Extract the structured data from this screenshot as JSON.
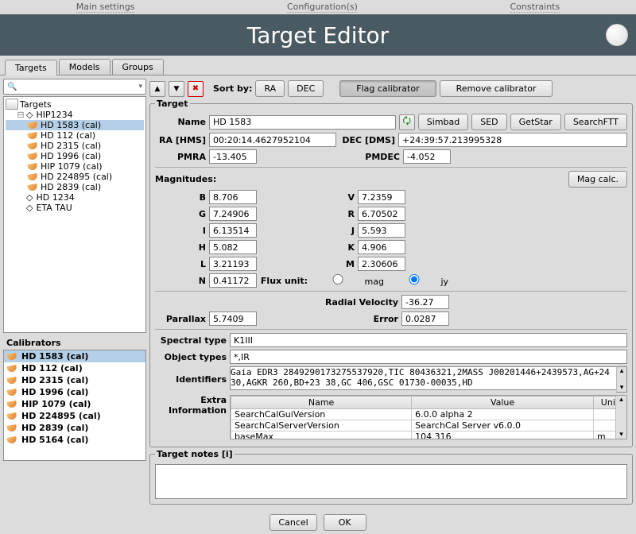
{
  "topmenu": {
    "main": "Main settings",
    "config": "Configuration(s)",
    "constraints": "Constraints"
  },
  "title": "Target Editor",
  "tabs": [
    "Targets",
    "Models",
    "Groups"
  ],
  "search_placeholder": "",
  "search_dropdown_icon": "▾",
  "tree_root": "Targets",
  "tree": [
    {
      "label": "HIP1234",
      "sub": [
        {
          "label": "HD 1583 (cal)",
          "selected": true
        },
        {
          "label": "HD 112 (cal)"
        },
        {
          "label": "HD 2315 (cal)"
        },
        {
          "label": "HD 1996 (cal)"
        },
        {
          "label": "HIP 1079 (cal)"
        },
        {
          "label": "HD 224895 (cal)"
        },
        {
          "label": "HD 2839 (cal)"
        }
      ]
    },
    {
      "label": "HD 1234"
    },
    {
      "label": "ETA TAU"
    }
  ],
  "calibs_title": "Calibrators",
  "calibrators": [
    {
      "label": "HD 1583 (cal)",
      "selected": true
    },
    {
      "label": "HD 112 (cal)"
    },
    {
      "label": "HD 2315 (cal)"
    },
    {
      "label": "HD 1996 (cal)"
    },
    {
      "label": "HIP 1079 (cal)"
    },
    {
      "label": "HD 224895 (cal)"
    },
    {
      "label": "HD 2839 (cal)"
    },
    {
      "label": "HD 5164 (cal)"
    }
  ],
  "toolbar": {
    "sort_by": "Sort by:",
    "ra": "RA",
    "dec": "DEC",
    "flag": "Flag calibrator",
    "remove": "Remove calibrator"
  },
  "target": {
    "legend": "Target",
    "name_label": "Name",
    "name": "HD 1583",
    "simbad": "Simbad",
    "sed": "SED",
    "getstar": "GetStar",
    "searchftt": "SearchFTT",
    "ra_label": "RA [HMS]",
    "ra": "00:20:14.4627952104",
    "dec_label": "DEC [DMS]",
    "dec": "+24:39:57.213995328",
    "pmra_label": "PMRA",
    "pmra": "-13.405",
    "pmdec_label": "PMDEC",
    "pmdec": "-4.052"
  },
  "mags": {
    "legend": "Magnitudes:",
    "calc": "Mag calc.",
    "B": "8.706",
    "V": "7.2359",
    "G": "7.24906",
    "R": "6.70502",
    "I": "6.13514",
    "J": "5.593",
    "H": "5.082",
    "K": "4.906",
    "L": "3.21193",
    "M": "2.30606",
    "N": "0.41172",
    "flux_unit_label": "Flux unit:",
    "mag": "mag",
    "jy": "jy"
  },
  "extra": {
    "rv_label": "Radial Velocity",
    "rv": "-36.27",
    "parallax_label": "Parallax",
    "parallax": "5.7409",
    "error_label": "Error",
    "error": "0.0287",
    "spectral_label": "Spectral type",
    "spectral": "K1III",
    "objtypes_label": "Object types",
    "objtypes": "*,IR",
    "identifiers_label": "Identifiers",
    "identifiers": "Gaia EDR3 2849290173275537920,TIC 80436321,2MASS J00201446+2439573,AG+24 30,AGKR 260,BD+23 38,GC 406,GSC 01730-00035,HD",
    "extra_info_label": "Extra Information",
    "headers": [
      "Name",
      "Value",
      "Unit"
    ],
    "rows": [
      [
        "SearchCalGuiVersion",
        "6.0.0 alpha 2",
        ""
      ],
      [
        "SearchCalServerVersion",
        "SearchCal Server v6.0.0",
        ""
      ],
      [
        "baseMax",
        "104.316",
        "m"
      ]
    ]
  },
  "notes": {
    "legend": "Target notes [i]"
  },
  "bottom": {
    "cancel": "Cancel",
    "ok": "OK"
  }
}
